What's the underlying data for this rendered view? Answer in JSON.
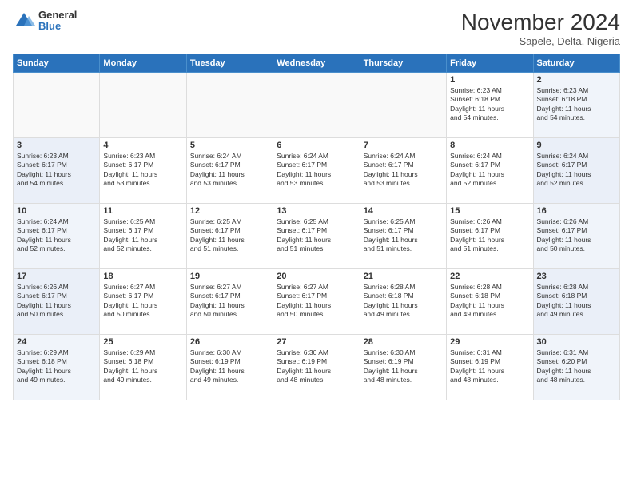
{
  "logo": {
    "general": "General",
    "blue": "Blue"
  },
  "title": "November 2024",
  "location": "Sapele, Delta, Nigeria",
  "weekdays": [
    "Sunday",
    "Monday",
    "Tuesday",
    "Wednesday",
    "Thursday",
    "Friday",
    "Saturday"
  ],
  "weeks": [
    [
      {
        "day": "",
        "info": ""
      },
      {
        "day": "",
        "info": ""
      },
      {
        "day": "",
        "info": ""
      },
      {
        "day": "",
        "info": ""
      },
      {
        "day": "",
        "info": ""
      },
      {
        "day": "1",
        "info": "Sunrise: 6:23 AM\nSunset: 6:18 PM\nDaylight: 11 hours\nand 54 minutes."
      },
      {
        "day": "2",
        "info": "Sunrise: 6:23 AM\nSunset: 6:18 PM\nDaylight: 11 hours\nand 54 minutes."
      }
    ],
    [
      {
        "day": "3",
        "info": "Sunrise: 6:23 AM\nSunset: 6:17 PM\nDaylight: 11 hours\nand 54 minutes."
      },
      {
        "day": "4",
        "info": "Sunrise: 6:23 AM\nSunset: 6:17 PM\nDaylight: 11 hours\nand 53 minutes."
      },
      {
        "day": "5",
        "info": "Sunrise: 6:24 AM\nSunset: 6:17 PM\nDaylight: 11 hours\nand 53 minutes."
      },
      {
        "day": "6",
        "info": "Sunrise: 6:24 AM\nSunset: 6:17 PM\nDaylight: 11 hours\nand 53 minutes."
      },
      {
        "day": "7",
        "info": "Sunrise: 6:24 AM\nSunset: 6:17 PM\nDaylight: 11 hours\nand 53 minutes."
      },
      {
        "day": "8",
        "info": "Sunrise: 6:24 AM\nSunset: 6:17 PM\nDaylight: 11 hours\nand 52 minutes."
      },
      {
        "day": "9",
        "info": "Sunrise: 6:24 AM\nSunset: 6:17 PM\nDaylight: 11 hours\nand 52 minutes."
      }
    ],
    [
      {
        "day": "10",
        "info": "Sunrise: 6:24 AM\nSunset: 6:17 PM\nDaylight: 11 hours\nand 52 minutes."
      },
      {
        "day": "11",
        "info": "Sunrise: 6:25 AM\nSunset: 6:17 PM\nDaylight: 11 hours\nand 52 minutes."
      },
      {
        "day": "12",
        "info": "Sunrise: 6:25 AM\nSunset: 6:17 PM\nDaylight: 11 hours\nand 51 minutes."
      },
      {
        "day": "13",
        "info": "Sunrise: 6:25 AM\nSunset: 6:17 PM\nDaylight: 11 hours\nand 51 minutes."
      },
      {
        "day": "14",
        "info": "Sunrise: 6:25 AM\nSunset: 6:17 PM\nDaylight: 11 hours\nand 51 minutes."
      },
      {
        "day": "15",
        "info": "Sunrise: 6:26 AM\nSunset: 6:17 PM\nDaylight: 11 hours\nand 51 minutes."
      },
      {
        "day": "16",
        "info": "Sunrise: 6:26 AM\nSunset: 6:17 PM\nDaylight: 11 hours\nand 50 minutes."
      }
    ],
    [
      {
        "day": "17",
        "info": "Sunrise: 6:26 AM\nSunset: 6:17 PM\nDaylight: 11 hours\nand 50 minutes."
      },
      {
        "day": "18",
        "info": "Sunrise: 6:27 AM\nSunset: 6:17 PM\nDaylight: 11 hours\nand 50 minutes."
      },
      {
        "day": "19",
        "info": "Sunrise: 6:27 AM\nSunset: 6:17 PM\nDaylight: 11 hours\nand 50 minutes."
      },
      {
        "day": "20",
        "info": "Sunrise: 6:27 AM\nSunset: 6:17 PM\nDaylight: 11 hours\nand 50 minutes."
      },
      {
        "day": "21",
        "info": "Sunrise: 6:28 AM\nSunset: 6:18 PM\nDaylight: 11 hours\nand 49 minutes."
      },
      {
        "day": "22",
        "info": "Sunrise: 6:28 AM\nSunset: 6:18 PM\nDaylight: 11 hours\nand 49 minutes."
      },
      {
        "day": "23",
        "info": "Sunrise: 6:28 AM\nSunset: 6:18 PM\nDaylight: 11 hours\nand 49 minutes."
      }
    ],
    [
      {
        "day": "24",
        "info": "Sunrise: 6:29 AM\nSunset: 6:18 PM\nDaylight: 11 hours\nand 49 minutes."
      },
      {
        "day": "25",
        "info": "Sunrise: 6:29 AM\nSunset: 6:18 PM\nDaylight: 11 hours\nand 49 minutes."
      },
      {
        "day": "26",
        "info": "Sunrise: 6:30 AM\nSunset: 6:19 PM\nDaylight: 11 hours\nand 49 minutes."
      },
      {
        "day": "27",
        "info": "Sunrise: 6:30 AM\nSunset: 6:19 PM\nDaylight: 11 hours\nand 48 minutes."
      },
      {
        "day": "28",
        "info": "Sunrise: 6:30 AM\nSunset: 6:19 PM\nDaylight: 11 hours\nand 48 minutes."
      },
      {
        "day": "29",
        "info": "Sunrise: 6:31 AM\nSunset: 6:19 PM\nDaylight: 11 hours\nand 48 minutes."
      },
      {
        "day": "30",
        "info": "Sunrise: 6:31 AM\nSunset: 6:20 PM\nDaylight: 11 hours\nand 48 minutes."
      }
    ]
  ]
}
